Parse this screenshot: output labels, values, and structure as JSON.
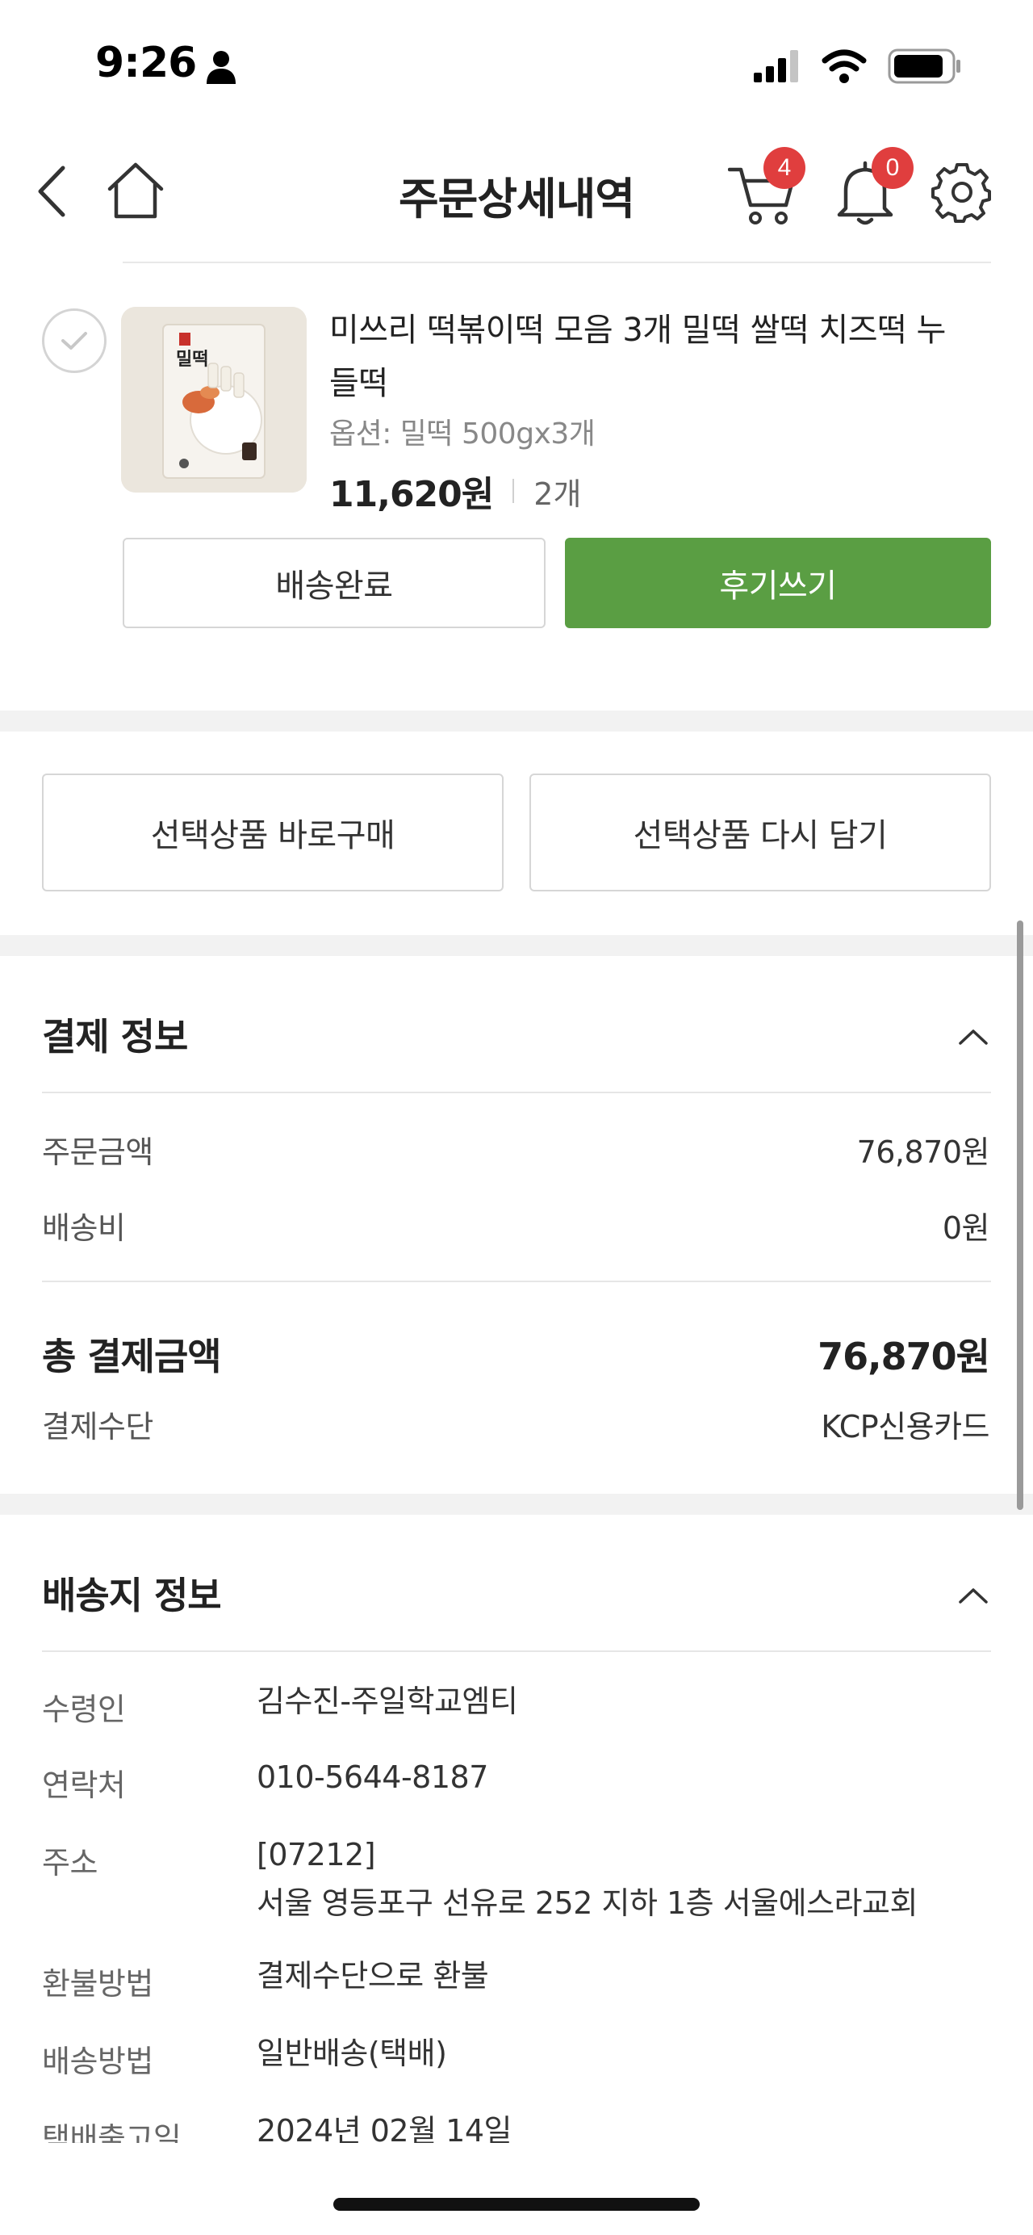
{
  "status_bar": {
    "time": "9:26"
  },
  "header": {
    "title": "주문상세내역",
    "cart_count": "4",
    "notification_count": "0"
  },
  "product": {
    "name": "미쓰리 떡볶이떡 모음 3개 밀떡 쌀떡 치즈떡 누들떡",
    "option": "옵션: 밀떡 500gx3개",
    "price": "11,620원",
    "quantity": "2개",
    "thumb_label": "밀떡",
    "status_button": "배송완료",
    "review_button": "후기쓰기"
  },
  "actions": {
    "buy_now": "선택상품 바로구매",
    "re_cart": "선택상품 다시 담기"
  },
  "payment": {
    "title": "결제 정보",
    "order_amount_label": "주문금액",
    "order_amount": "76,870원",
    "shipping_fee_label": "배송비",
    "shipping_fee": "0원",
    "total_label": "총 결제금액",
    "total": "76,870원",
    "method_label": "결제수단",
    "method": "KCP신용카드"
  },
  "shipping": {
    "title": "배송지 정보",
    "recipient_label": "수령인",
    "recipient": "김수진-주일학교엠티",
    "phone_label": "연락처",
    "phone": "010-5644-8187",
    "address_label": "주소",
    "postal_code": "[07212]",
    "address": "서울 영등포구 선유로 252 지하 1층 서울에스라교회",
    "refund_label": "환불방법",
    "refund": "결제수단으로 환불",
    "delivery_method_label": "배송방법",
    "delivery_method": "일반배송(택배)",
    "ship_date_label": "택배출고일",
    "ship_date": "2024년 02월 14일"
  },
  "colors": {
    "accent_green": "#5a9e43",
    "badge_red": "#e03e3e"
  },
  "icons": [
    "back-arrow-icon",
    "home-icon",
    "cart-icon",
    "bell-icon",
    "gear-icon",
    "check-icon",
    "chevron-up-icon"
  ]
}
